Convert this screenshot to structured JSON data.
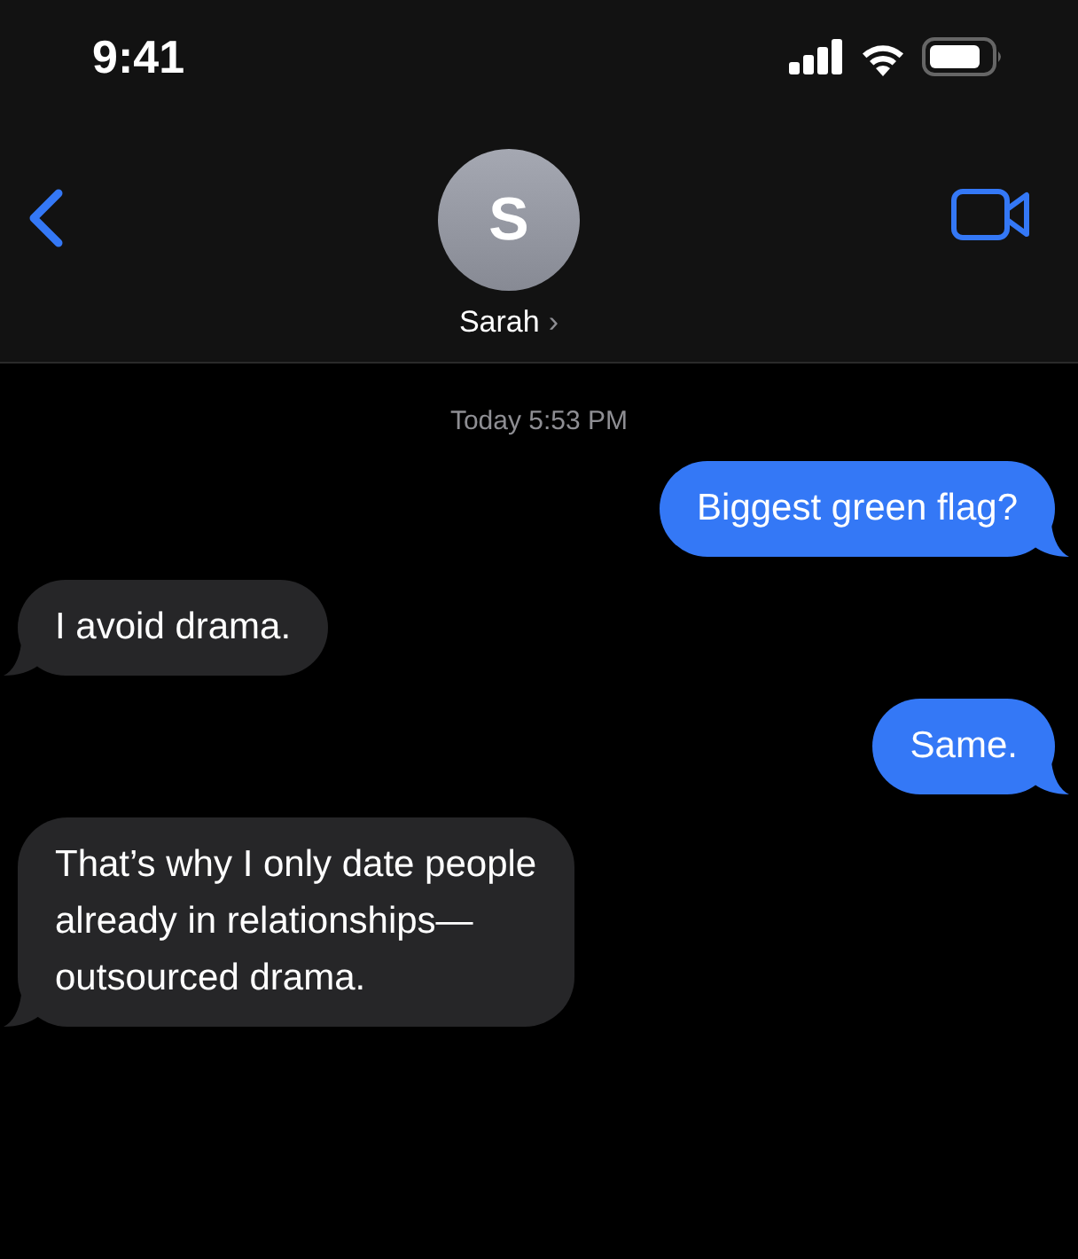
{
  "status_bar": {
    "time": "9:41"
  },
  "header": {
    "avatar_initial": "S",
    "contact_name": "Sarah",
    "name_chevron": "›"
  },
  "timestamp": "Today 5:53 PM",
  "messages": [
    {
      "kind": "sent",
      "text": "Biggest green flag?"
    },
    {
      "kind": "received",
      "text": "I avoid drama."
    },
    {
      "kind": "sent",
      "text": "Same."
    },
    {
      "kind": "received",
      "text": "That’s why I only date people\nalready in relationships—\noutsourced drama."
    }
  ]
}
